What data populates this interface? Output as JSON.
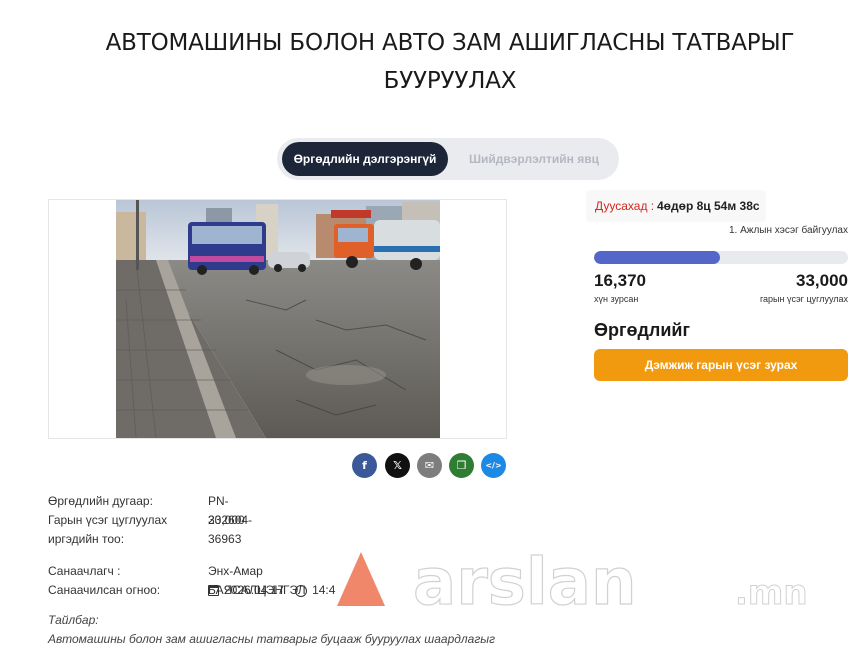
{
  "title": "АВТОМАШИНЫ БОЛОН АВТО ЗАМ АШИГЛАСНЫ ТАТВАРЫГ БУУРУУЛАХ",
  "tabs": {
    "active": "Өргөдлийн дэлгэрэнгүй",
    "inactive": "Шийдвэрлэлтийн явц"
  },
  "share": [
    {
      "name": "facebook-icon",
      "glyph": "f",
      "color": "#3b5998"
    },
    {
      "name": "x-icon",
      "glyph": "𝕏",
      "color": "#111111"
    },
    {
      "name": "email-icon",
      "glyph": "✉",
      "color": "#7d7d7d"
    },
    {
      "name": "copy-icon",
      "glyph": "❐",
      "color": "#2e7d32"
    },
    {
      "name": "embed-icon",
      "glyph": "</>",
      "color": "#1e88e5"
    }
  ],
  "details": {
    "number_label": "Өргөдлийн дугаар:",
    "number_value": "PN-202604-36963",
    "signatures_label": "Гарын үсэг цуглуулах иргэдийн тоо:",
    "signatures_value": "33,000",
    "initiator_label": "Санаачлагч :",
    "initiator_value": "Энх-Амар БАЯСАЛЦЭНГЭЛ",
    "date_label": "Санаачилсан огноо:",
    "date_value": "2026.04.17",
    "time_value": "14:4"
  },
  "countdown": {
    "label": "Дуусахад :",
    "value": "4өдөр 8ц 54м 38с",
    "level_note": "1. Ажлын хэсэг байгуулах"
  },
  "progress": {
    "collected": "16,370",
    "collected_label": "хүн зурсан",
    "goal": "33,000",
    "goal_label": "гарын үсэг цуглуулах",
    "fraction": 0.496
  },
  "sign": {
    "heading": "Өргөдлийг",
    "button": "Дэмжиж гарын үсэг зурах"
  },
  "note": {
    "label": "Тайлбар:",
    "text": "Автомашины болон зам ашигласны татварыг буцааж бууруулах шаардлагыг"
  },
  "watermark": {
    "text": "arslan",
    "suffix": ".mn",
    "accent": "#f07a5a"
  },
  "colors": {
    "accent": "#f29a0f",
    "progress": "#5566c9",
    "tab_active": "#1d2638",
    "countdown_label": "#d2291f"
  }
}
